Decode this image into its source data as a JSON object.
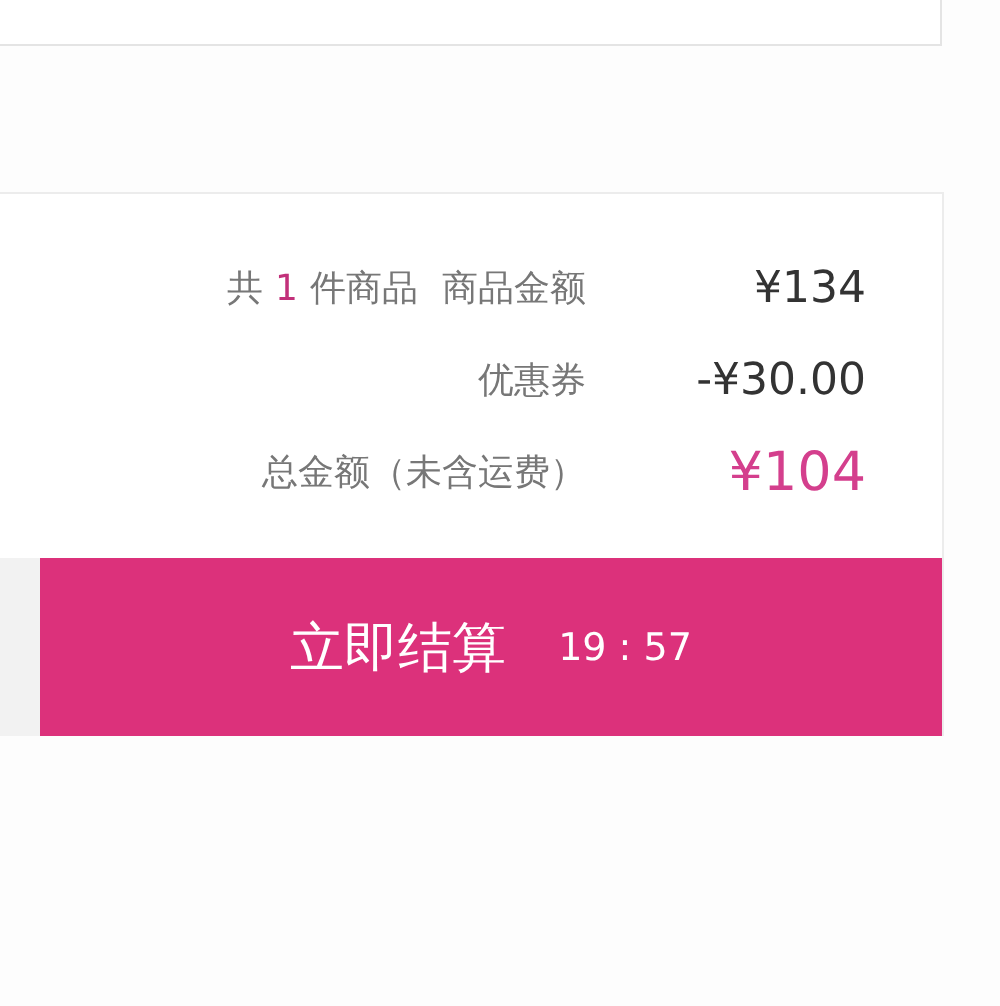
{
  "summary": {
    "item_count_prefix": "共",
    "item_count": "1",
    "item_count_suffix": "件商品",
    "rows": [
      {
        "label": "商品金额",
        "value": "¥134",
        "kind": "plain"
      },
      {
        "label": "优惠券",
        "value": "-¥30.00",
        "kind": "plain"
      },
      {
        "label": "总金额（未含运费）",
        "value": "¥104",
        "kind": "total"
      }
    ]
  },
  "checkout_button": {
    "label": "立即结算",
    "countdown": "19 : 57"
  }
}
